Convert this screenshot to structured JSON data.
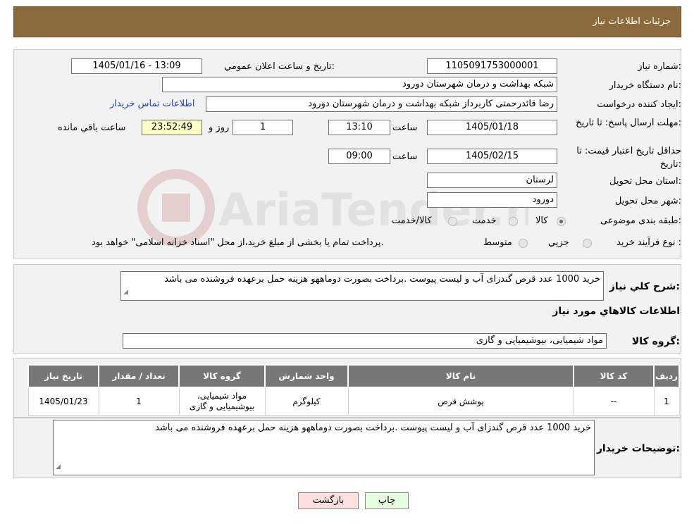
{
  "header": {
    "title": "جزئیات اطلاعات نیاز"
  },
  "form": {
    "need_number_label": "شماره نیاز:",
    "need_number": "1105091753000001",
    "announce_label": "تاریخ و ساعت اعلان عمومي:",
    "announce_value": "1405/01/16 - 13:09",
    "buyer_org_label": "نام دستگاه خريدار:",
    "buyer_org": "شبکه بهداشت و درمان شهرستان دورود",
    "creator_label": "ايجاد کننده درخواست:",
    "creator": "رضا قائدرحمتی کاربرداز شبکه بهداشت و درمان شهرستان دورود",
    "contact_link": "اطلاعات تماس خريدار",
    "deadline_label": "مهلت ارسال پاسخ: تا تاريخ:",
    "deadline_date": "1405/01/18",
    "time_word": "ساعت",
    "deadline_time": "13:10",
    "days_remaining": "1",
    "days_and_label": "روز و",
    "remaining_time": "23:52:49",
    "remaining_label": "ساعت باقي مانده",
    "validity_label": "حداقل تاريخ اعتبار قيمت: تا تاريخ:",
    "validity_date": "1405/02/15",
    "validity_time": "09:00",
    "province_label": "استان محل تحويل:",
    "province": "لرستان",
    "city_label": "شهر محل تحويل:",
    "city": "دورود",
    "category_label": "طبقه بندی موضوعی:",
    "category_options": [
      "کالا",
      "خدمت",
      "کالا/خدمت"
    ],
    "category_selected": "کالا",
    "process_label": "نوع فرآيند خريد :",
    "process_options": [
      "جزيي",
      "متوسط"
    ],
    "process_note": "پرداخت تمام يا بخشی از مبلغ خريد،از محل \"اسناد خزانه اسلامی\" خواهد بود."
  },
  "summary": {
    "description_label": "شرح کلي نياز:",
    "description": "خريد 1000 عدد قرص گندزای آب و ليست پيوست .برداخت بصورت دوماههو هزينه حمل برعهده فروشنده می باشد",
    "goods_info_title": "اطلاعات کالاهاي مورد نياز",
    "goods_group_label": "گروه کالا:",
    "goods_group": "مواد شيميايی، بيوشيميايی و  گازی"
  },
  "table": {
    "headers": [
      "رديف",
      "کد کالا",
      "نام کالا",
      "واحد شمارش",
      "گروه کالا",
      "تعداد / مقدار",
      "تاريخ نياز"
    ],
    "rows": [
      [
        "1",
        "--",
        "پوشش قرص",
        "کيلوگرم",
        "مواد شيميايی، بيوشيميايی و گازی",
        "1",
        "1405/01/23"
      ]
    ]
  },
  "buyer_notes": {
    "label": "توضيحات خريدار:",
    "text": "خريد 1000 عدد قرص گندزای آب و ليست پيوست .برداخت بصورت دوماههو هزينه حمل برعهده فروشنده می باشد"
  },
  "buttons": {
    "print": "چاپ",
    "back": "بازگشت"
  },
  "watermark": {
    "text": "AriaTender.neT"
  },
  "colors": {
    "header": "#8b6a3e",
    "table_header": "#777777",
    "link": "#1e3cc8",
    "back_button": "#ffe0e0",
    "print_button": "#e6ffe0"
  }
}
